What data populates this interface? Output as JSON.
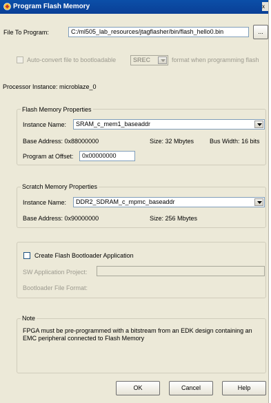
{
  "window": {
    "title": "Program Flash Memory",
    "close_glyph": "x"
  },
  "file": {
    "label": "File To Program:",
    "value": "C:/ml505_lab_resources/jtagflasher/bin/flash_hello0.bin",
    "browse_label": "..."
  },
  "autoconvert": {
    "label": "Auto-convert file to bootloadable",
    "format_value": "SREC",
    "suffix": "format when programming flash"
  },
  "processor": {
    "text": "Processor Instance:  microblaze_0"
  },
  "flash": {
    "title": "Flash Memory Properties",
    "instance_label": "Instance Name:",
    "instance_value": "SRAM_c_mem1_baseaddr",
    "base_text": "Base Address:  0x88000000",
    "size_text": "Size:  32 Mbytes",
    "buswidth_text": "Bus Width:  16 bits",
    "offset_label": "Program at Offset:",
    "offset_value": "0x00000000"
  },
  "scratch": {
    "title": "Scratch Memory Properties",
    "instance_label": "Instance Name:",
    "instance_value": "DDR2_SDRAM_c_mpmc_baseaddr",
    "base_text": "Base Address:  0x90000000",
    "size_text": "Size:  256 Mbytes"
  },
  "bootloader": {
    "checkbox_label": "Create Flash Bootloader Application",
    "sw_label": "SW Application Project:",
    "format_label": "Bootloader File Format:"
  },
  "note": {
    "title": "Note",
    "text": "FPGA must be pre-programmed with a bitstream from an EDK design containing an EMC peripheral connected to Flash Memory"
  },
  "buttons": {
    "ok": "OK",
    "cancel": "Cancel",
    "help": "Help"
  },
  "colors": {
    "titlebar": "#0a3f96",
    "dialog": "#ece9d8"
  }
}
